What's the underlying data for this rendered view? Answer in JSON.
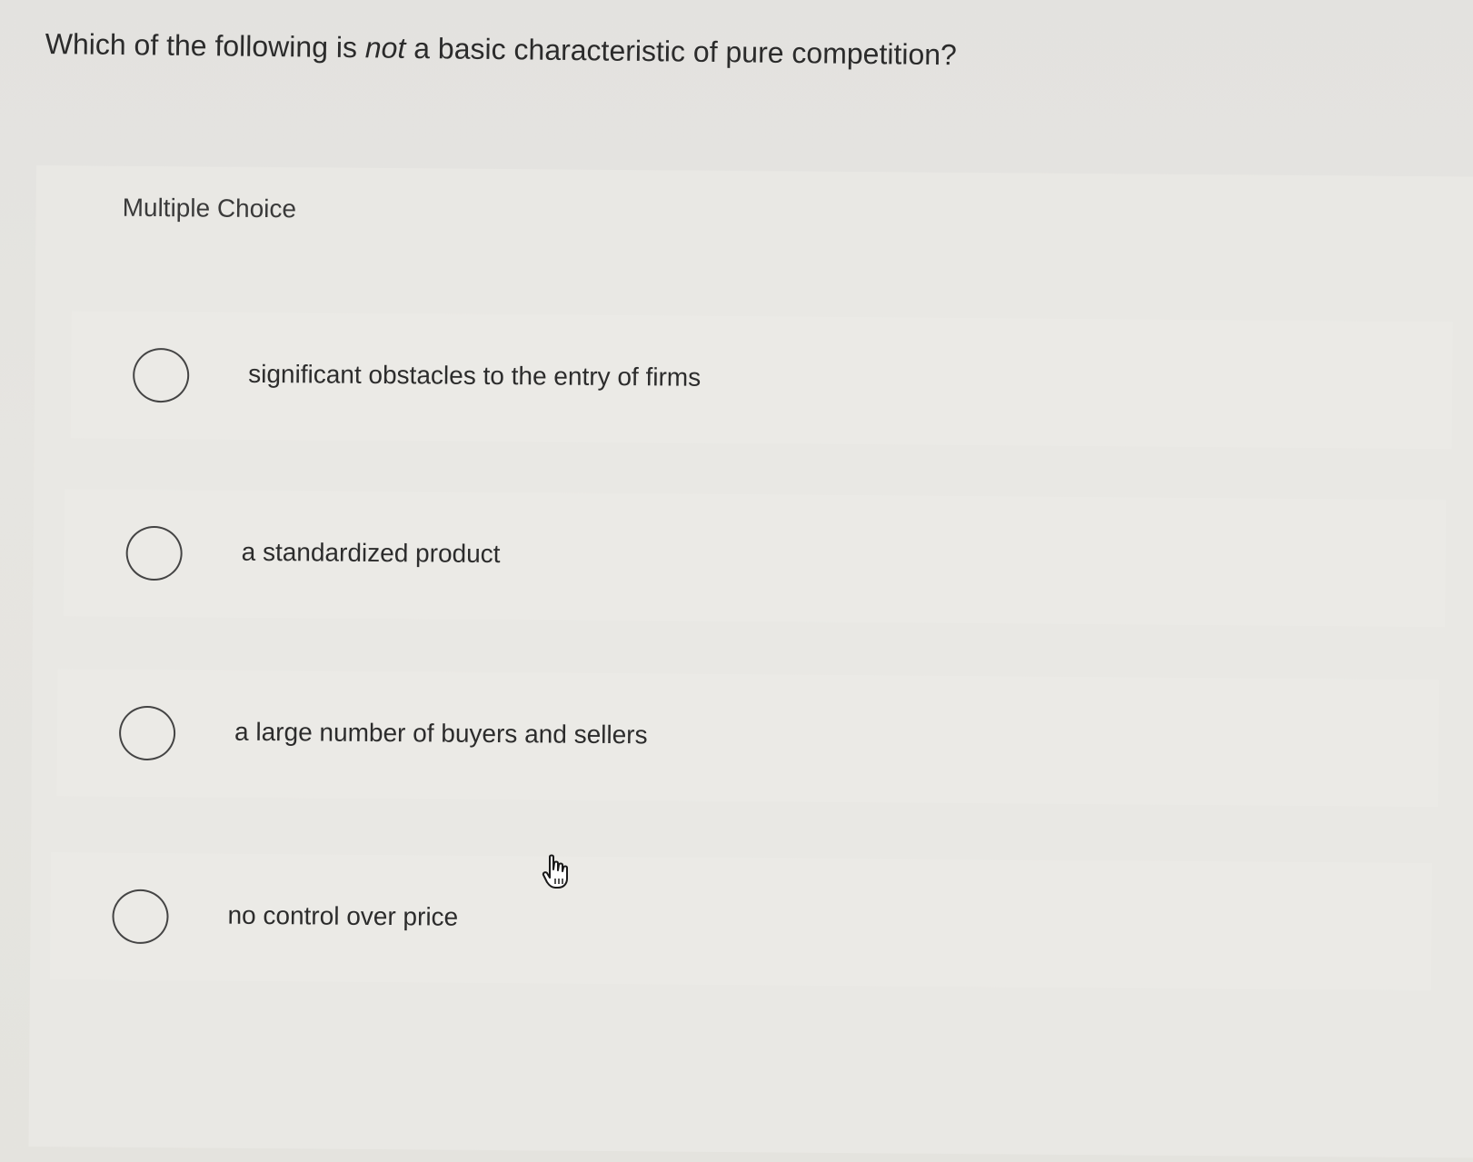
{
  "question": {
    "before": "Which of the following is ",
    "emphasis": "not",
    "after": " a basic characteristic of pure competition?"
  },
  "quiz": {
    "type_label": "Multiple Choice",
    "options": [
      {
        "label": "significant obstacles to the entry of firms",
        "selected": false
      },
      {
        "label": "a standardized product",
        "selected": false
      },
      {
        "label": "a large number of buyers and sellers",
        "selected": false
      },
      {
        "label": "no control over price",
        "selected": false
      }
    ]
  },
  "cursor": {
    "icon": "hand-pointer-icon"
  }
}
